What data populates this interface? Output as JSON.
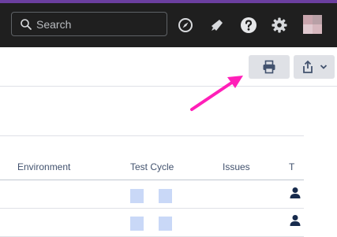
{
  "header": {
    "search": {
      "placeholder": "Search"
    },
    "icons": [
      "compass-icon",
      "megaphone-icon",
      "help-icon",
      "settings-icon",
      "avatar"
    ]
  },
  "toolbar": {
    "print_icon": "printer-icon",
    "share_icon": "share-icon",
    "chevron_icon": "chevron-down-icon"
  },
  "table": {
    "columns": [
      "Environment",
      "Test Cycle",
      "Issues",
      "T"
    ],
    "rows": [
      {
        "environment": "",
        "test_cycle": "",
        "issues": "",
        "t_icon": "person-icon"
      },
      {
        "environment": "",
        "test_cycle": "",
        "issues": "",
        "t_icon": "person-icon"
      }
    ]
  },
  "colors": {
    "header_bg": "#1f1f1f",
    "accent_strip": "#6b3fa0",
    "button_bg": "#dfe1e6",
    "annotation_arrow": "#ff1fb8",
    "icon_dark": "#172b4d"
  }
}
